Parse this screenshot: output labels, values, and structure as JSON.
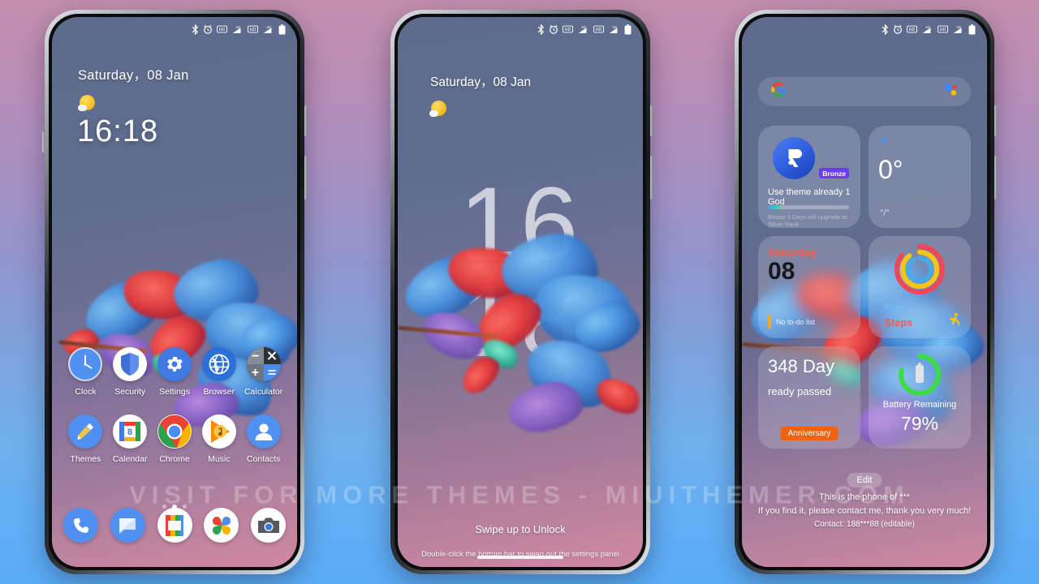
{
  "watermark": "VISIT FOR MORE THEMES - MIUITHEMER.COM",
  "statusbar": {
    "icons": [
      "bluetooth-icon",
      "alarm-icon",
      "hd-call-icon",
      "signal-4g-icon",
      "hd-call-icon-2",
      "signal-4g-icon-2",
      "battery-icon"
    ]
  },
  "home": {
    "date": "Saturday，08 Jan",
    "weather_icon": "sun-icon",
    "clock": "16:18",
    "apps": [
      {
        "label": "Clock",
        "icon": "clock-icon"
      },
      {
        "label": "Security",
        "icon": "shield-icon"
      },
      {
        "label": "Settings",
        "icon": "gear-icon"
      },
      {
        "label": "Browser",
        "icon": "globe-icon"
      },
      {
        "label": "Calculator",
        "icon": "calculator-icon"
      },
      {
        "label": "Themes",
        "icon": "paintbrush-icon"
      },
      {
        "label": "Calendar",
        "icon": "calendar-icon"
      },
      {
        "label": "Chrome",
        "icon": "chrome-icon"
      },
      {
        "label": "Music",
        "icon": "play-music-icon"
      },
      {
        "label": "Contacts",
        "icon": "person-icon"
      }
    ],
    "calendar_day": "8",
    "page_dots": 3,
    "active_dot": 1,
    "dock": [
      {
        "label": "Phone",
        "icon": "phone-icon"
      },
      {
        "label": "Messages",
        "icon": "message-icon"
      },
      {
        "label": "Files",
        "icon": "files-icon"
      },
      {
        "label": "Photos",
        "icon": "photos-icon"
      },
      {
        "label": "Camera",
        "icon": "camera-icon"
      }
    ]
  },
  "lock": {
    "date": "Saturday，08 Jan",
    "weather_icon": "sun-icon",
    "hour": "16",
    "minute": "18",
    "swipe_text": "Swipe up to Unlock",
    "hint_text": "Double-click the bottom bar to swap out the settings panel"
  },
  "widgets": {
    "search_placeholder": "",
    "search_left_icon": "google-g-icon",
    "search_right_icon": "google-assistant-icon",
    "theme": {
      "logo": "theme-r-logo-icon",
      "badge": "Bronze",
      "title": "Use theme already 1 God",
      "progress_percent": 16,
      "subtitle": "Reuse 9 Days will upgrade to Silver Rank"
    },
    "weather": {
      "location_icon": "location-arrow-icon",
      "temperature": "0°",
      "range": "°/°"
    },
    "calendar": {
      "weekday": "Saturday",
      "day": "08",
      "todo": "No to-do list"
    },
    "steps": {
      "kcal_label": "Kcal",
      "steps_label": "Steps",
      "icon": "running-person-icon",
      "ring_outer_color": "#f0465a",
      "ring_mid_color": "#f5c518",
      "ring_inner_color": "#4aa8e8"
    },
    "anniversary": {
      "days": "348 Day",
      "subtitle": "ready passed",
      "badge": "Anniversary"
    },
    "battery": {
      "label": "Battery Remaining",
      "percent": "79%",
      "percent_value": 79,
      "ring_color": "#3ddc47",
      "icon": "battery-vertical-icon"
    },
    "edit_button": "Edit",
    "lost_line1": "This is the phone of ***",
    "lost_line2": "If you find it, please contact me, thank you very much!",
    "lost_line3": "Contact: 188***88 (editable)"
  }
}
